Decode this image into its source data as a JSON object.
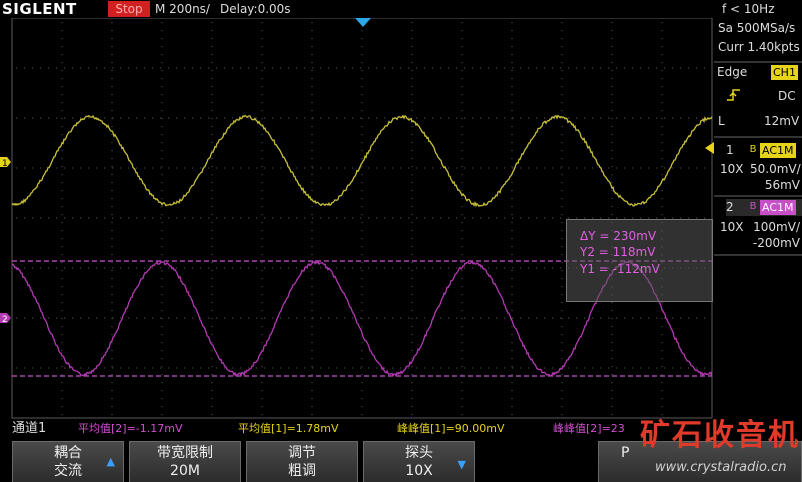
{
  "header": {
    "brand": "SIGLENT",
    "run_state": "Stop",
    "timebase": "M 200ns/",
    "delay": "Delay:0.00s",
    "frequency": "f < 10Hz"
  },
  "side_panel": {
    "sample_rate": "Sa 500MSa/s",
    "record_length": "Curr 1.40kpts",
    "trigger_type": "Edge",
    "trigger_source": "CH1",
    "trigger_coupling": "DC",
    "trigger_level_label": "L",
    "trigger_level": "12mV",
    "ch1": {
      "num": "1",
      "bw": "B",
      "coupling": "AC1M",
      "probe": "10X",
      "scale": "50.0mV/",
      "offset": "56mV"
    },
    "ch2": {
      "num": "2",
      "bw": "B",
      "coupling": "AC1M",
      "probe": "10X",
      "scale": "100mV/",
      "offset": "-200mV"
    }
  },
  "channel_markers": {
    "ch1": "1",
    "ch2": "2"
  },
  "cursors": {
    "delta_y": "ΔY = 230mV",
    "y2": "Y2 = 118mV",
    "y1": "Y1 = -112mV"
  },
  "measurements": {
    "channel_label": "通道1",
    "m1": "平均值[2]=-1.17mV",
    "m2": "平均值[1]=1.78mV",
    "m3": "峰峰值[1]=90.00mV",
    "m4": "峰峰值[2]=23"
  },
  "softkeys": [
    {
      "l1": "耦合",
      "l2": "交流",
      "arrow": "▲"
    },
    {
      "l1": "带宽限制",
      "l2": "20M",
      "arrow": ""
    },
    {
      "l1": "调节",
      "l2": "粗调",
      "arrow": ""
    },
    {
      "l1": "探头",
      "l2": "10X",
      "arrow": "▼"
    },
    {
      "l1": "",
      "l2": "P",
      "arrow": ""
    }
  ],
  "watermark": {
    "cn": "矿石收音机",
    "url": "www.crystalradio.cn"
  },
  "colors": {
    "ch1": "#c8c038",
    "ch2": "#b33ab3",
    "cursor": "#e060e0",
    "stop": "#d21f1f",
    "accent": "#3aa0ff"
  }
}
